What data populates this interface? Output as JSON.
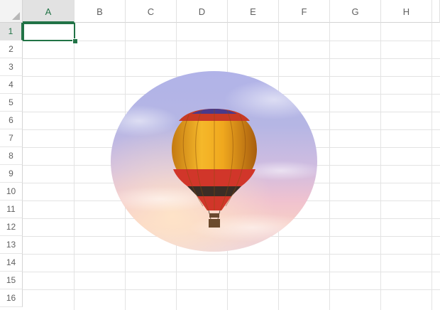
{
  "columns": [
    "A",
    "B",
    "C",
    "D",
    "E",
    "F",
    "G",
    "H"
  ],
  "rows": [
    "1",
    "2",
    "3",
    "4",
    "5",
    "6",
    "7",
    "8",
    "9",
    "10",
    "11",
    "12",
    "13",
    "14",
    "15",
    "16"
  ],
  "active_cell": "A1",
  "colors": {
    "accent": "#217346",
    "grid": "#e3e3e3",
    "header_bg": "#e2e2e2"
  },
  "picture": {
    "shape": "oval",
    "subject": "hot air balloon in sky at sunset"
  }
}
